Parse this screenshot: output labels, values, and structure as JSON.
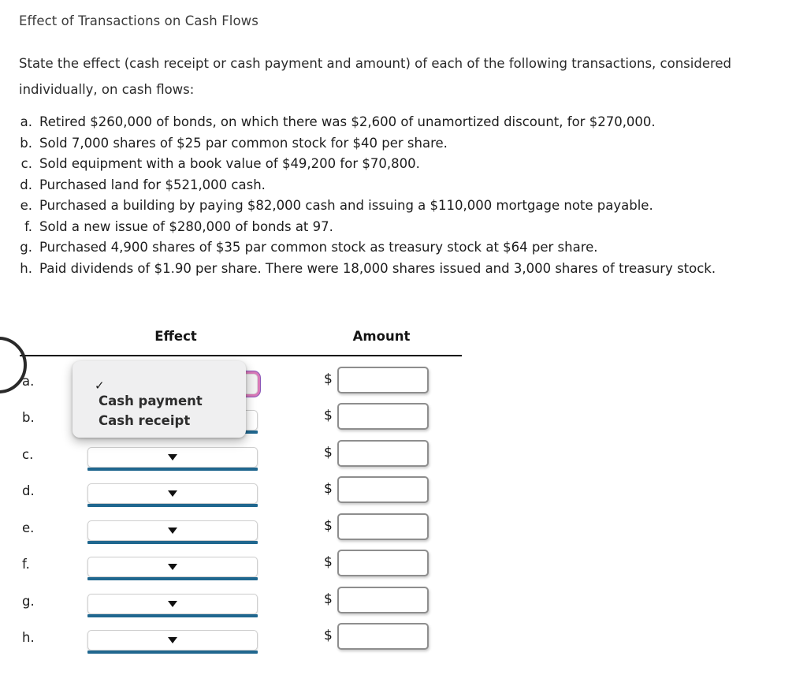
{
  "title": "Effect of Transactions on Cash Flows",
  "intro": "State the effect (cash receipt or cash payment and amount) of each of the following transactions, considered individually, on cash flows:",
  "transactions": [
    {
      "marker": "a.",
      "text": "Retired $260,000 of bonds, on which there was $2,600 of unamortized discount, for $270,000."
    },
    {
      "marker": "b.",
      "text": "Sold 7,000 shares of $25 par common stock for $40 per share."
    },
    {
      "marker": "c.",
      "text": "Sold equipment with a book value of $49,200 for $70,800."
    },
    {
      "marker": "d.",
      "text": "Purchased land for $521,000 cash."
    },
    {
      "marker": "e.",
      "text": "Purchased a building by paying $82,000 cash and issuing a $110,000 mortgage note payable."
    },
    {
      "marker": "f.",
      "text": "Sold a new issue of $280,000 of bonds at 97."
    },
    {
      "marker": "g.",
      "text": "Purchased 4,900 shares of $35 par common stock as treasury stock at $64 per share."
    },
    {
      "marker": "h.",
      "text": "Paid dividends of $1.90 per share. There were 18,000 shares issued and 3,000 shares of treasury stock."
    }
  ],
  "table": {
    "headers": {
      "effect": "Effect",
      "amount": "Amount"
    },
    "currency_symbol": "$",
    "rows": [
      {
        "label": "a.",
        "effect_value": "",
        "amount_value": "",
        "focused": true
      },
      {
        "label": "b.",
        "effect_value": "",
        "amount_value": "",
        "focused": false
      },
      {
        "label": "c.",
        "effect_value": "",
        "amount_value": "",
        "focused": false
      },
      {
        "label": "d.",
        "effect_value": "",
        "amount_value": "",
        "focused": false
      },
      {
        "label": "e.",
        "effect_value": "",
        "amount_value": "",
        "focused": false
      },
      {
        "label": "f.",
        "effect_value": "",
        "amount_value": "",
        "focused": false
      },
      {
        "label": "g.",
        "effect_value": "",
        "amount_value": "",
        "focused": false
      },
      {
        "label": "h.",
        "effect_value": "",
        "amount_value": "",
        "focused": false
      }
    ]
  },
  "dropdown": {
    "open": true,
    "for_row": "a.",
    "selected_index": 0,
    "check_glyph": "✓",
    "options": [
      {
        "label": "",
        "selected": true
      },
      {
        "label": "Cash payment",
        "selected": false
      },
      {
        "label": "Cash receipt",
        "selected": false
      }
    ]
  },
  "icons": {
    "caret_down": "caret-down-icon",
    "checkmark": "checkmark-icon"
  },
  "colors": {
    "select_underline": "#20678f",
    "focus_ring_start": "#d87ab8",
    "focus_ring_end": "#8a57b8",
    "rule": "#000000",
    "text": "#1d1d1d"
  }
}
